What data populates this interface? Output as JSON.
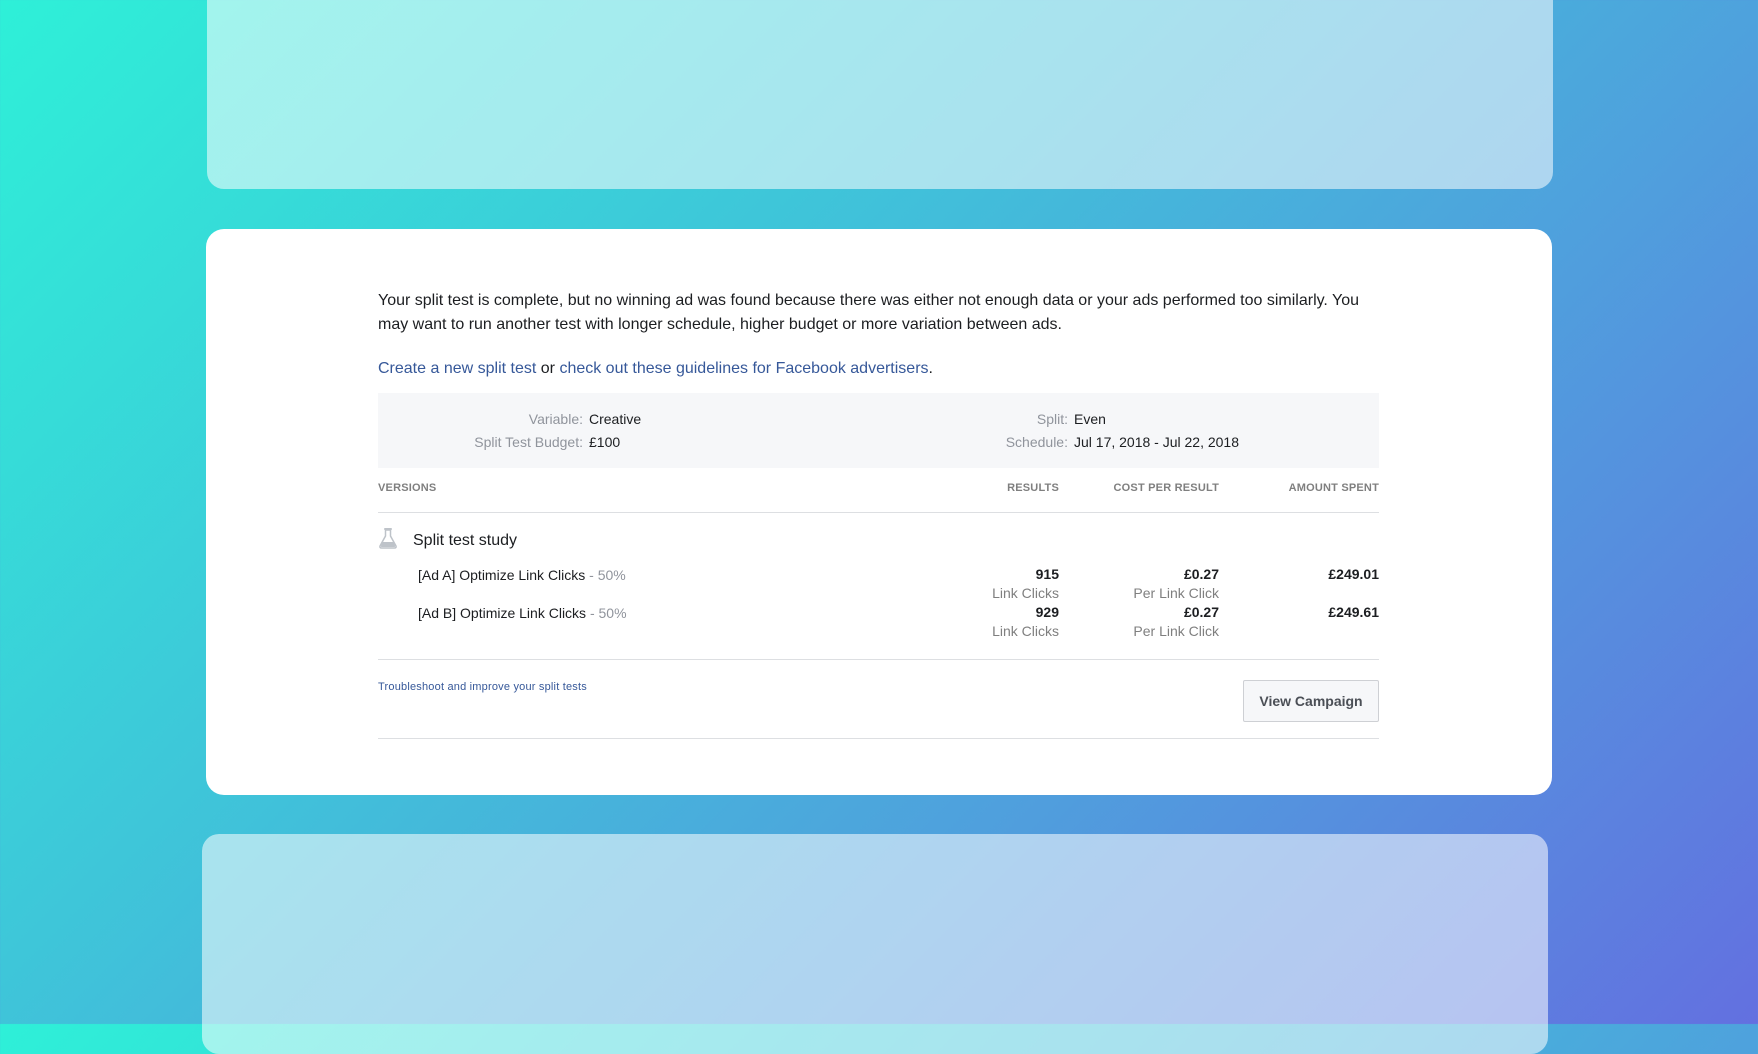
{
  "intro": {
    "text": "Your split test is complete, but no winning ad was found because there was either not enough data or your ads performed too similarly. You may want to run another test with longer schedule, higher budget or more variation between ads."
  },
  "links": {
    "create": "Create a new split test",
    "or": "or",
    "guidelines": "check out these guidelines for Facebook advertisers",
    "period": "."
  },
  "summary": {
    "variable_label": "Variable:",
    "variable_value": "Creative",
    "budget_label": "Split Test Budget:",
    "budget_value": "£100",
    "split_label": "Split:",
    "split_value": "Even",
    "schedule_label": "Schedule:",
    "schedule_value": "Jul 17, 2018 - Jul 22, 2018"
  },
  "table": {
    "headers": {
      "versions": "VERSIONS",
      "results": "RESULTS",
      "cost": "COST PER RESULT",
      "amount": "AMOUNT SPENT"
    },
    "study": {
      "icon": "flask-icon",
      "name": "Split test study"
    },
    "ads": [
      {
        "name": "[Ad A] Optimize Link Clicks",
        "split": " - 50%",
        "results": "915",
        "results_unit": "Link Clicks",
        "cost": "£0.27",
        "cost_unit": "Per Link Click",
        "amount": "£249.01"
      },
      {
        "name": "[Ad B] Optimize Link Clicks",
        "split": " - 50%",
        "results": "929",
        "results_unit": "Link Clicks",
        "cost": "£0.27",
        "cost_unit": "Per Link Click",
        "amount": "£249.61"
      }
    ]
  },
  "footer": {
    "troubleshoot": "Troubleshoot and improve your split tests",
    "view_campaign": "View Campaign"
  },
  "colors": {
    "link": "#365899",
    "muted": "#90949c",
    "panel": "#f6f7f9"
  }
}
